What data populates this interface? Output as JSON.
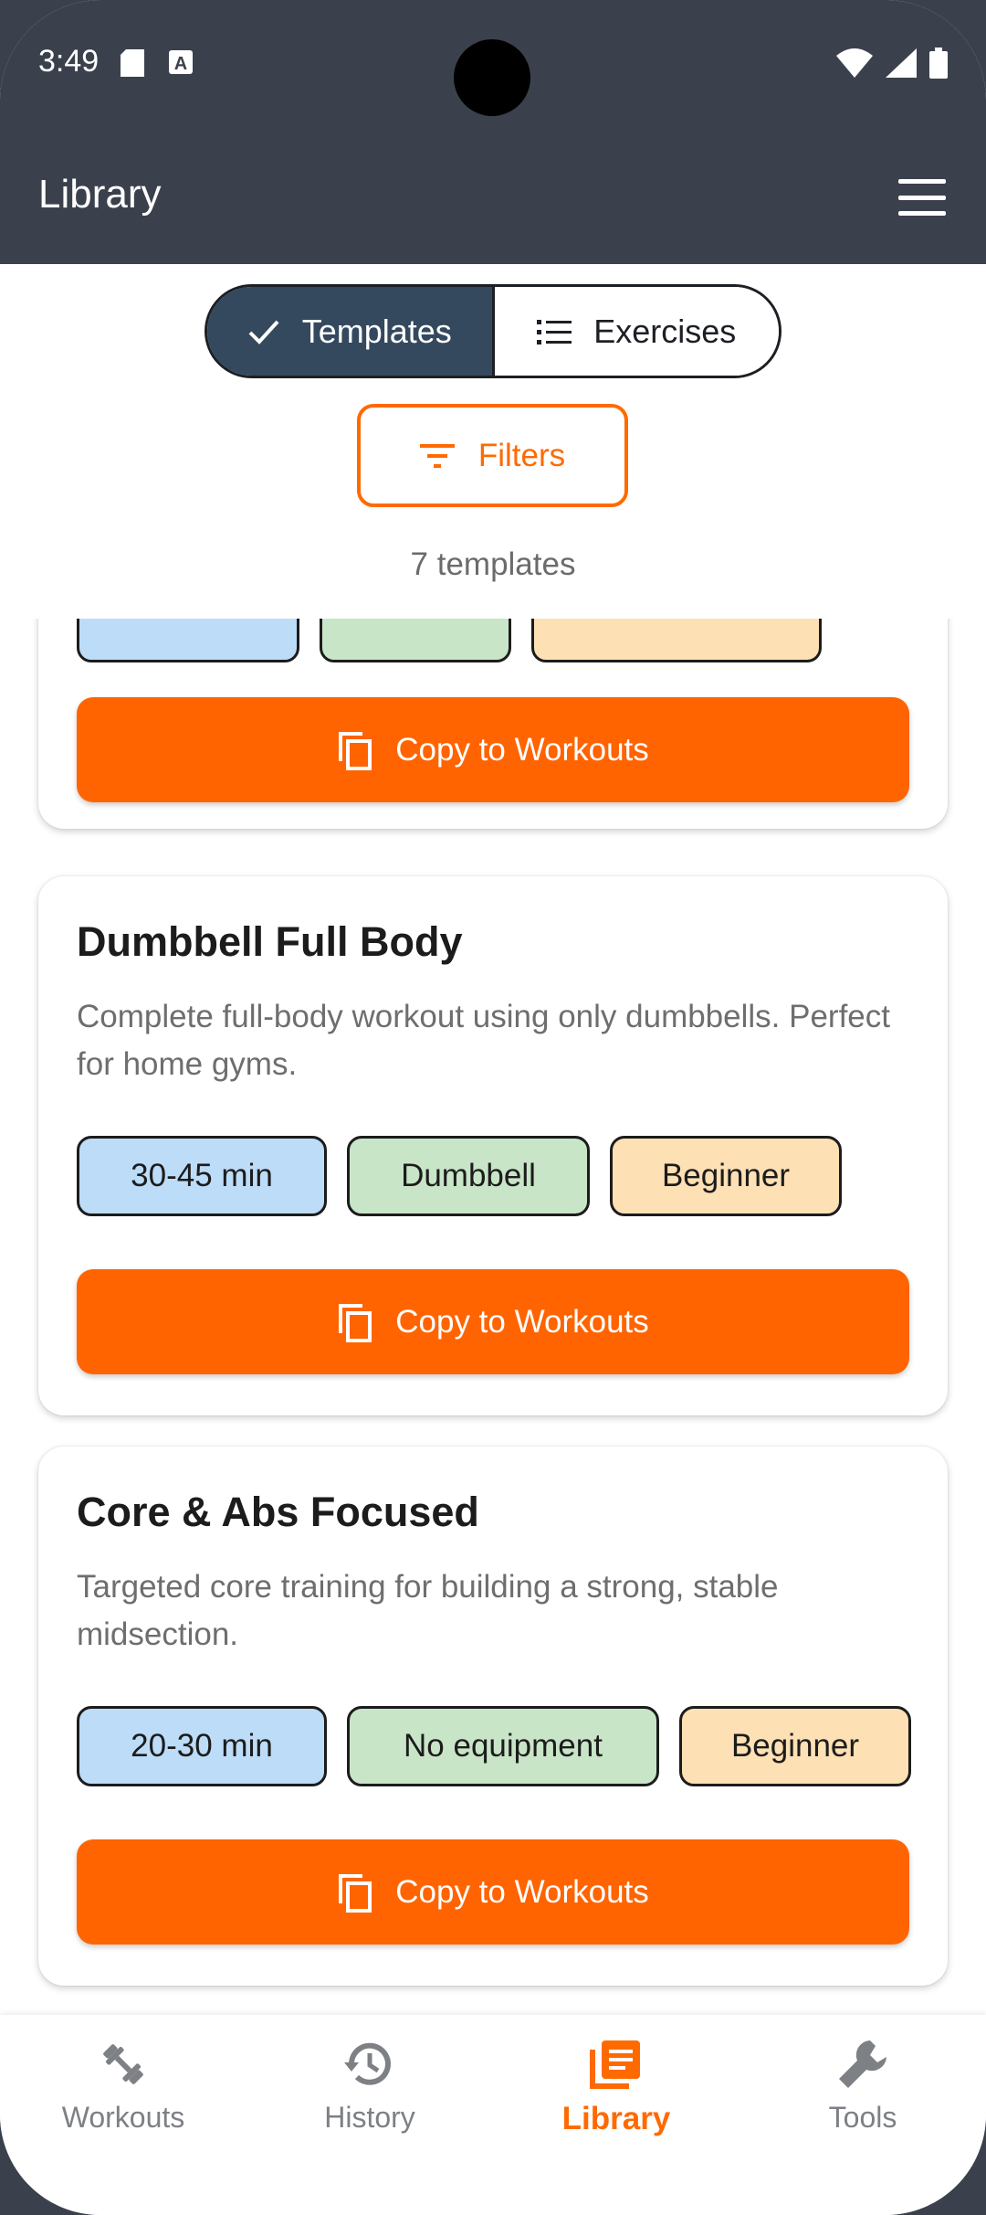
{
  "status_bar": {
    "time": "3:49"
  },
  "app_bar": {
    "title": "Library"
  },
  "segments": {
    "templates": "Templates",
    "exercises": "Exercises"
  },
  "filters_label": "Filters",
  "template_count": "7 templates",
  "cards": [
    {
      "title": "Dumbbell Full Body",
      "description": "Complete full-body workout using only dumbbells. Perfect for home gyms.",
      "chips": [
        "30-45 min",
        "Dumbbell",
        "Beginner"
      ],
      "action": "Copy to Workouts"
    },
    {
      "title": "Core & Abs Focused",
      "description": "Targeted core training for building a strong, stable midsection.",
      "chips": [
        "20-30 min",
        "No equipment",
        "Beginner"
      ],
      "action": "Copy to Workouts"
    }
  ],
  "partial_card": {
    "action": "Copy to Workouts"
  },
  "nav": [
    {
      "label": "Workouts",
      "icon": "dumbbell-icon"
    },
    {
      "label": "History",
      "icon": "history-icon"
    },
    {
      "label": "Library",
      "icon": "library-icon"
    },
    {
      "label": "Tools",
      "icon": "wrench-icon"
    }
  ],
  "colors": {
    "accent": "#ff6400",
    "header": "#3b414c",
    "segment_active": "#34495e",
    "chip_time": "#bddcf8",
    "chip_equipment": "#c9e5c8",
    "chip_level": "#fde0b4"
  }
}
